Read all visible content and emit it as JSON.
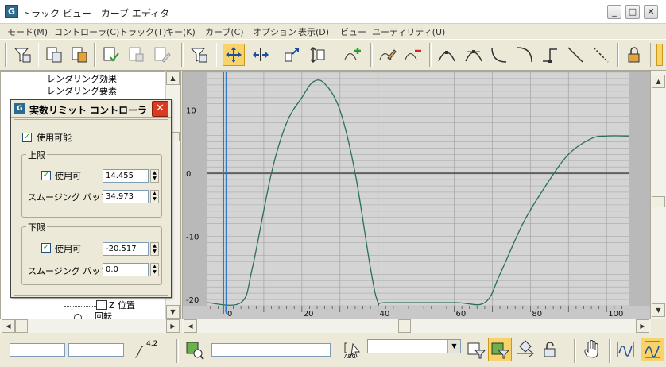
{
  "window": {
    "title": "トラック ビュー - カーブ エディタ",
    "minimize": "_",
    "maximize": "□",
    "close": "✕"
  },
  "menu": [
    "モード(M)",
    "コントローラ(C)",
    "トラック(T)",
    "キー(K)",
    "カーブ(C)",
    "オプション",
    "表示(D)",
    "ビュー",
    "ユーティリティ(U)"
  ],
  "tree": {
    "items": [
      {
        "label": "レンダリング効果"
      },
      {
        "label": "レンダリング要素"
      },
      {
        "label": "Z 位置"
      },
      {
        "label": "回転"
      }
    ]
  },
  "dialog": {
    "title": "実数リミット コントローラ",
    "close": "✕",
    "enabled_label": "使用可能",
    "upper": {
      "title": "上限",
      "enabled_label": "使用可",
      "value": "14.455",
      "smoothing_label": "スムージング バッフ",
      "smoothing_value": "34.973"
    },
    "lower": {
      "title": "下限",
      "enabled_label": "使用可",
      "value": "-20.517",
      "smoothing_label": "スムージング バッフ",
      "smoothing_value": "0.0"
    }
  },
  "graph": {
    "y_ticks": [
      "10",
      "0",
      "-10",
      "-20"
    ],
    "x_ticks": [
      "0",
      "20",
      "40",
      "60",
      "80",
      "100"
    ]
  },
  "chart_data": {
    "type": "line",
    "x": [
      -5,
      4,
      7,
      12,
      16,
      20,
      23,
      26,
      30,
      34,
      38,
      40,
      42,
      60,
      68,
      72,
      78,
      84,
      90,
      96,
      100,
      106
    ],
    "values": [
      -20.5,
      -20.5,
      -15,
      0,
      8,
      12,
      14.5,
      14.2,
      10,
      0,
      -15,
      -20.5,
      -20.5,
      -20.5,
      -20.5,
      -16,
      -8,
      -2,
      3,
      5.5,
      5.9,
      5.9
    ],
    "ylim": [
      -21,
      16
    ],
    "xlim": [
      -5,
      106
    ],
    "y_ticks": [
      -20,
      -10,
      0,
      10
    ],
    "x_ticks": [
      0,
      20,
      40,
      60,
      80,
      100
    ],
    "current_frame": 0,
    "colors": {
      "curve": "#2a6f5a",
      "time_slider": "#2f77c9",
      "bg": "#b9b9b9",
      "plot_bg": "#d4d4d4"
    }
  },
  "status": {
    "zoom_label": "4.2",
    "abc_label": "ABC"
  }
}
